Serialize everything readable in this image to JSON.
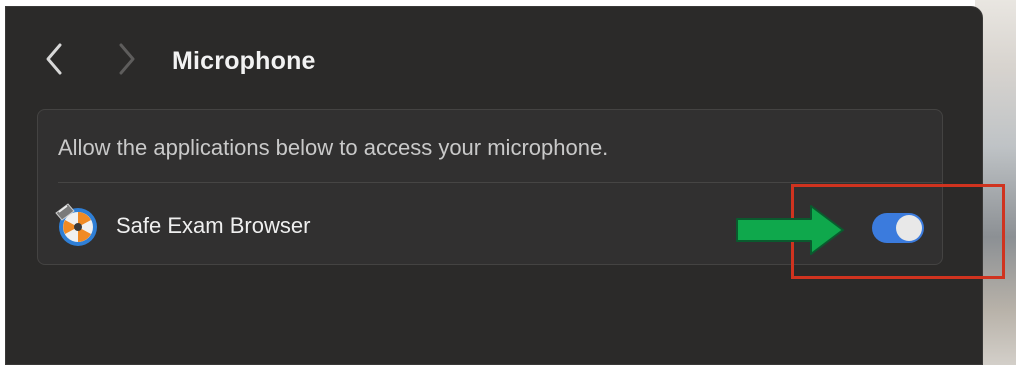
{
  "header": {
    "title": "Microphone"
  },
  "panel": {
    "description": "Allow the applications below to access your microphone.",
    "apps": [
      {
        "name": "Safe Exam Browser",
        "enabled": true,
        "icon": "safe-exam-browser-icon"
      }
    ]
  },
  "annotations": {
    "highlight_color": "#d0331f",
    "arrow_color": "#0fa84c"
  },
  "colors": {
    "toggle_on": "#3b7bdd",
    "window_bg": "#2b2a29"
  }
}
